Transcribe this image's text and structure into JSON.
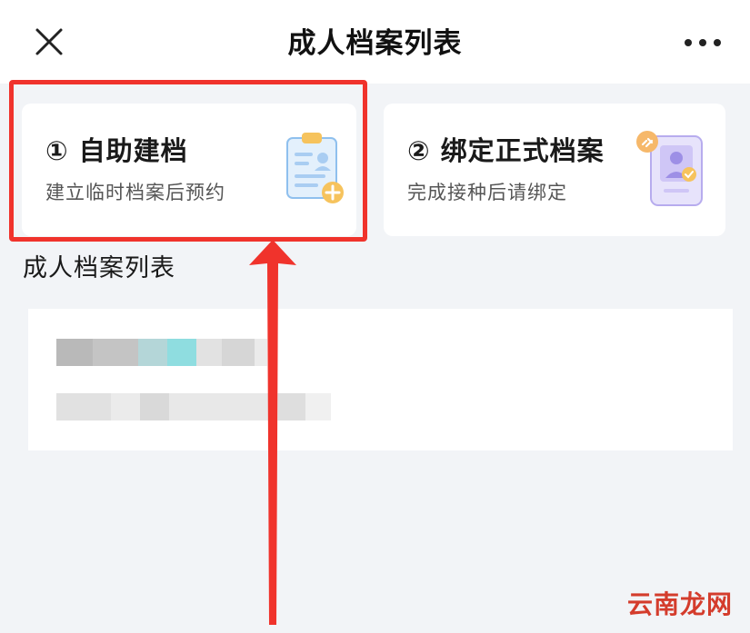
{
  "nav": {
    "title": "成人档案列表",
    "close_icon": "close-icon",
    "more_icon": "more-horizontal-icon"
  },
  "cards": [
    {
      "title": "① 自助建档",
      "subtitle": "建立临时档案后预约",
      "icon": "clipboard-add-icon"
    },
    {
      "title": "② 绑定正式档案",
      "subtitle": "完成接种后请绑定",
      "icon": "phone-id-link-icon"
    }
  ],
  "section": {
    "title": "成人档案列表"
  },
  "colors": {
    "highlight": "#f0332c",
    "background": "#f2f4f7",
    "card": "#ffffff",
    "watermark": "#d43c2c"
  },
  "watermark": "云南龙网"
}
